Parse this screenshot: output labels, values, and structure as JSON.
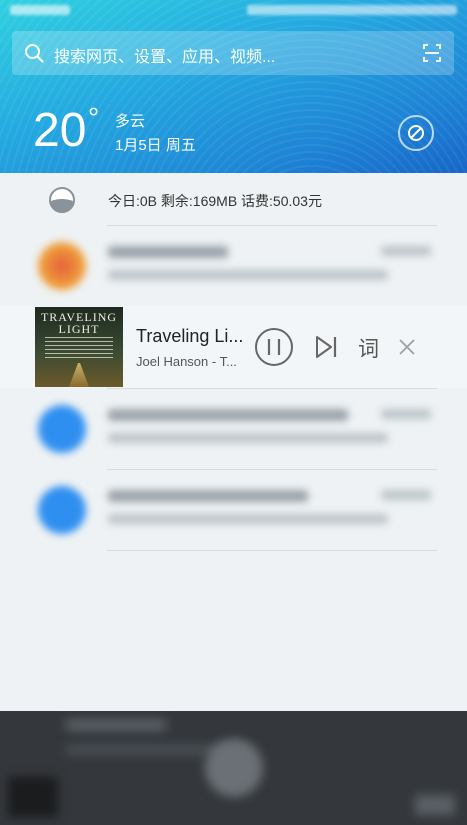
{
  "search": {
    "placeholder": "搜索网页、设置、应用、视频..."
  },
  "weather": {
    "temperature": "20",
    "condition": "多云",
    "date": "1月5日 周五"
  },
  "data_usage": {
    "text": "今日:0B   剩余:169MB   话费:50.03元"
  },
  "music": {
    "title": "Traveling Li...",
    "artist": "Joel Hanson - T...",
    "lyrics_label": "词",
    "cover_title": "TRAVELING LIGHT"
  },
  "colors": {
    "header_start": "#2fd0e0",
    "header_end": "#1766c8",
    "panel_bg": "#eef2f4",
    "accent_blue": "#2f8ff0"
  }
}
